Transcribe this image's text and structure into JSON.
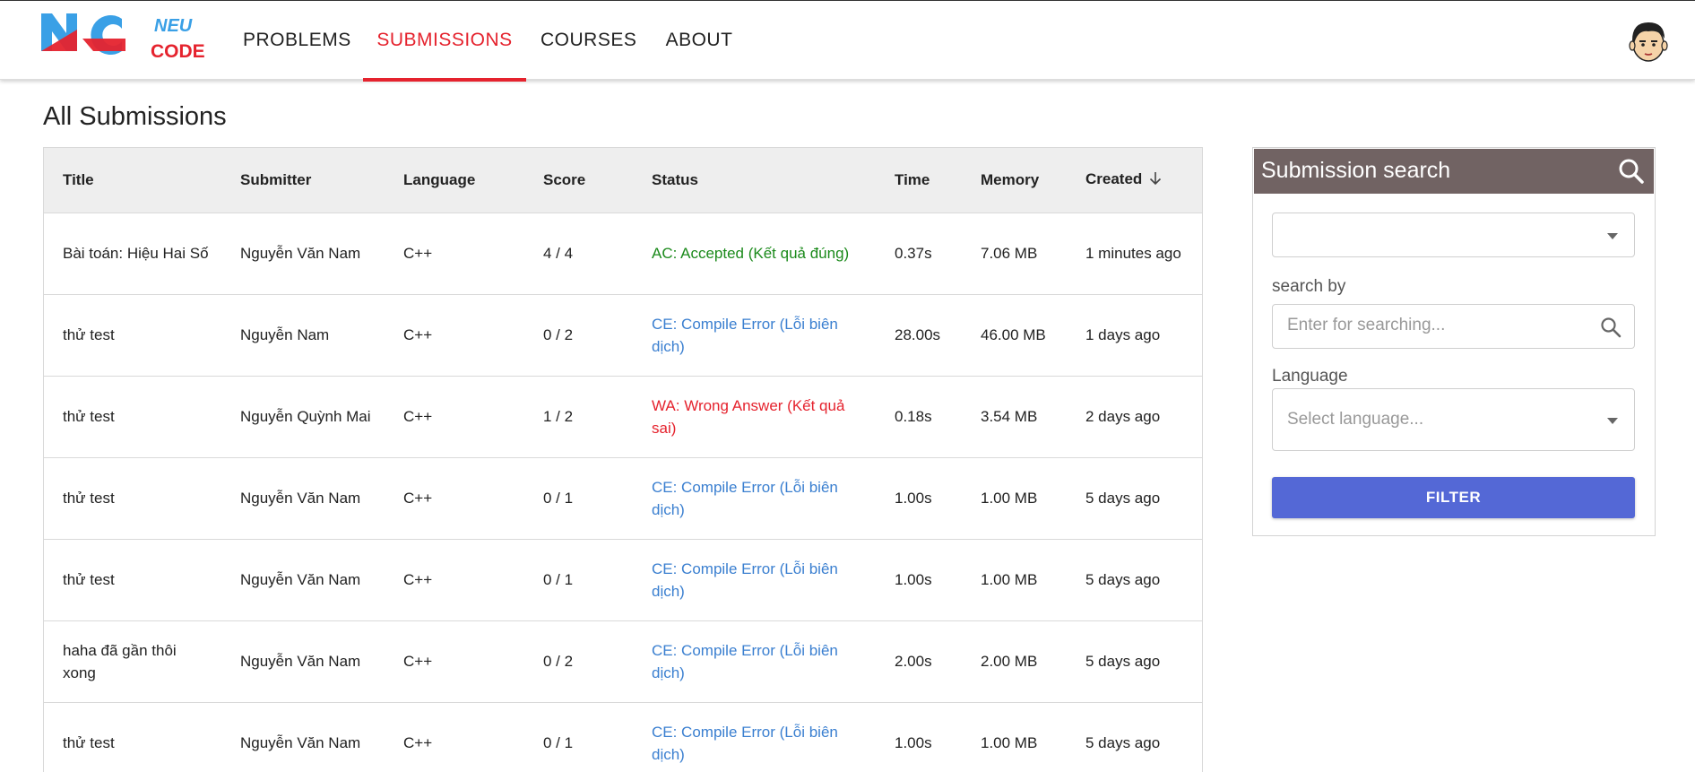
{
  "brand": {
    "logo_text_top": "NEU",
    "logo_text_bottom": "CODE",
    "logo_mark": "NC",
    "colors": {
      "red": "#e5232e",
      "blue": "#3aa0e6"
    }
  },
  "nav": {
    "items": [
      {
        "label": "PROBLEMS",
        "active": false
      },
      {
        "label": "SUBMISSIONS",
        "active": true
      },
      {
        "label": "COURSES",
        "active": false
      },
      {
        "label": "ABOUT",
        "active": false
      }
    ],
    "active_color": "#e5232e"
  },
  "page": {
    "title": "All Submissions"
  },
  "table": {
    "headers": [
      "Title",
      "Submitter",
      "Language",
      "Score",
      "Status",
      "Time",
      "Memory",
      "Created"
    ],
    "sort_icon": "arrow-down-icon",
    "rows": [
      {
        "title": "Bài toán: Hiệu Hai Số",
        "submitter": "Nguyễn Văn Nam",
        "language": "C++",
        "score": "4 / 4",
        "status": "AC: Accepted (Kết quả đúng)",
        "status_kind": "ac",
        "time": "0.37s",
        "memory": "7.06 MB",
        "created": "1 minutes ago"
      },
      {
        "title": "thử test",
        "submitter": "Nguyễn Nam",
        "language": "C++",
        "score": "0 / 2",
        "status": "CE: Compile Error (Lỗi biên dịch)",
        "status_kind": "ce",
        "time": "28.00s",
        "memory": "46.00 MB",
        "created": "1 days ago"
      },
      {
        "title": "thử test",
        "submitter": "Nguyễn Quỳnh Mai",
        "language": "C++",
        "score": "1 / 2",
        "status": "WA: Wrong Answer (Kết quả sai)",
        "status_kind": "wa",
        "time": "0.18s",
        "memory": "3.54 MB",
        "created": "2 days ago"
      },
      {
        "title": "thử test",
        "submitter": "Nguyễn Văn Nam",
        "language": "C++",
        "score": "0 / 1",
        "status": "CE: Compile Error (Lỗi biên dịch)",
        "status_kind": "ce",
        "time": "1.00s",
        "memory": "1.00 MB",
        "created": "5 days ago"
      },
      {
        "title": "thử test",
        "submitter": "Nguyễn Văn Nam",
        "language": "C++",
        "score": "0 / 1",
        "status": "CE: Compile Error (Lỗi biên dịch)",
        "status_kind": "ce",
        "time": "1.00s",
        "memory": "1.00 MB",
        "created": "5 days ago"
      },
      {
        "title": "haha đã gần thôi xong",
        "submitter": "Nguyễn Văn Nam",
        "language": "C++",
        "score": "0 / 2",
        "status": "CE: Compile Error (Lỗi biên dịch)",
        "status_kind": "ce",
        "time": "2.00s",
        "memory": "2.00 MB",
        "created": "5 days ago"
      },
      {
        "title": "thử test",
        "submitter": "Nguyễn Văn Nam",
        "language": "C++",
        "score": "0 / 1",
        "status": "CE: Compile Error (Lỗi biên dịch)",
        "status_kind": "ce",
        "time": "1.00s",
        "memory": "1.00 MB",
        "created": "5 days ago"
      }
    ],
    "status_colors": {
      "ac": "#1b8a1b",
      "ce": "#3a7fd0",
      "wa": "#e5232e"
    }
  },
  "search_panel": {
    "title": "Submission search",
    "header_color": "#716363",
    "select_value": "",
    "search_by_label": "search by",
    "search_placeholder": "Enter for searching...",
    "language_label": "Language",
    "language_placeholder": "Select language...",
    "filter_label": "FILTER",
    "button_color": "#5468d6"
  }
}
